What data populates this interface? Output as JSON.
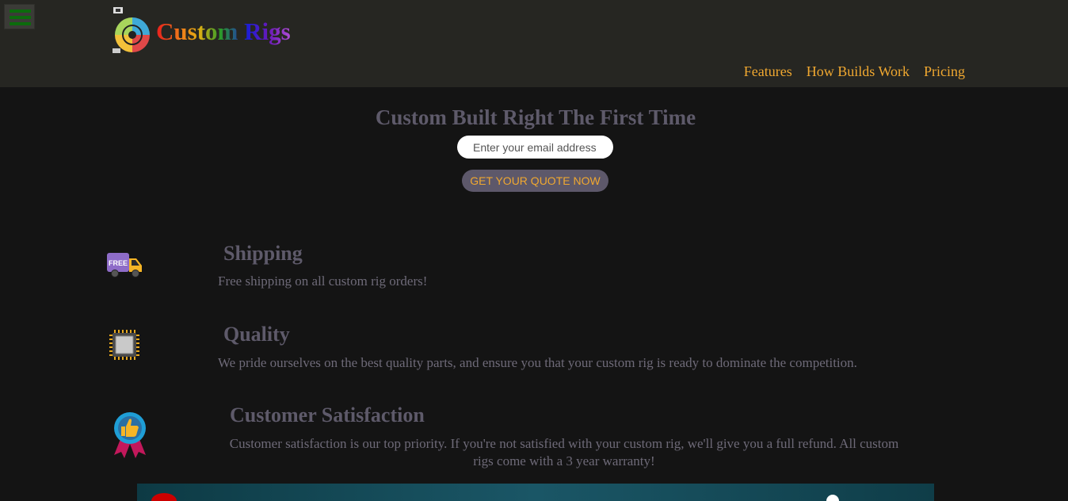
{
  "brand": {
    "name": "Custom Rigs"
  },
  "nav": {
    "features": "Features",
    "how_builds_work": "How Builds Work",
    "pricing": "Pricing"
  },
  "hero": {
    "title": "Custom Built Right The First Time",
    "email_placeholder": "Enter your email address",
    "quote_button": "GET YOUR QUOTE NOW"
  },
  "features": {
    "shipping": {
      "icon": "free-shipping-truck-icon",
      "badge": "FREE",
      "title": "Shipping",
      "text": "Free shipping on all custom rig orders!"
    },
    "quality": {
      "icon": "cpu-chip-icon",
      "title": "Quality",
      "text": "We pride ourselves on the best quality parts, and ensure you that your custom rig is ready to dominate the competition."
    },
    "satisfaction": {
      "icon": "thumbs-up-badge-icon",
      "title": "Customer Satisfaction",
      "text": "Customer satisfaction is our top priority. If you're not satisfied with your custom rig, we'll give you a full refund. All custom rigs come with a 3 year warranty!"
    }
  },
  "colors": {
    "header_bg": "#262622",
    "page_bg": "#141414",
    "accent": "#f0a830",
    "heading": "#5e5a6a",
    "menu_bars": "#0c6b0c"
  }
}
